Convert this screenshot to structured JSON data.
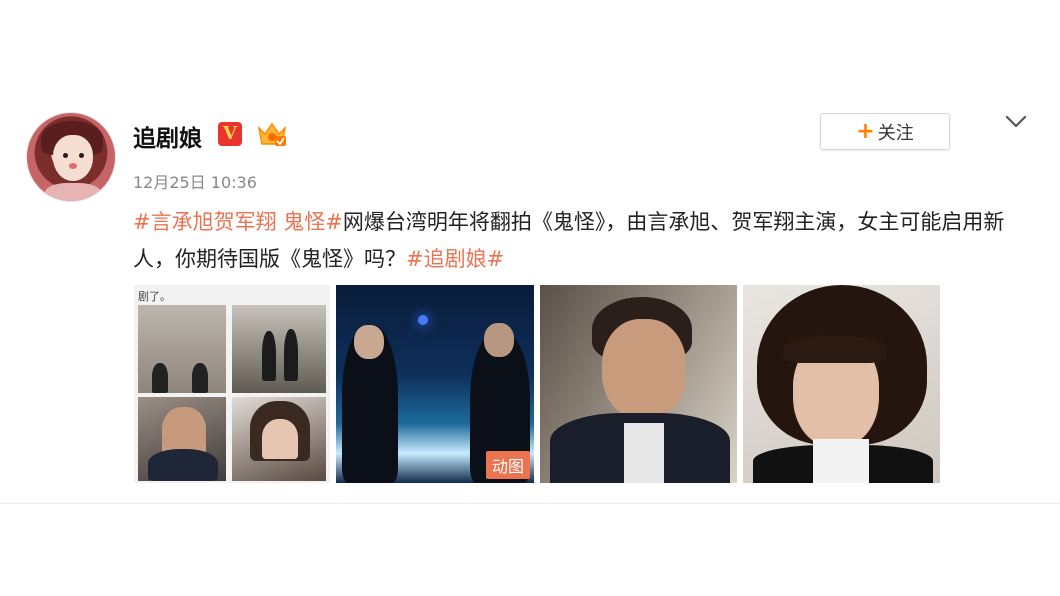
{
  "user": {
    "name": "追剧娘",
    "verified_badge": "V",
    "timestamp": "12月25日 10:36",
    "follow_label": "关注"
  },
  "post": {
    "topic1": "#言承旭贺军翔 鬼怪#",
    "text_part1": "网爆台湾明年将翻拍《鬼怪》，由言承旭、贺军翔主演，女主可能启用新人，你期待国版《鬼怪》吗？",
    "topic2": "#追剧娘#"
  },
  "images": [
    {
      "caption": "剧了。"
    },
    {
      "tag": "动图"
    },
    {},
    {}
  ],
  "colors": {
    "topic": "#eb7350",
    "follow_plus": "#ff8200",
    "verified": "#e8342d"
  },
  "icons": [
    "verified-v-icon",
    "vip-crown-icon",
    "plus-icon",
    "chevron-down-icon"
  ]
}
